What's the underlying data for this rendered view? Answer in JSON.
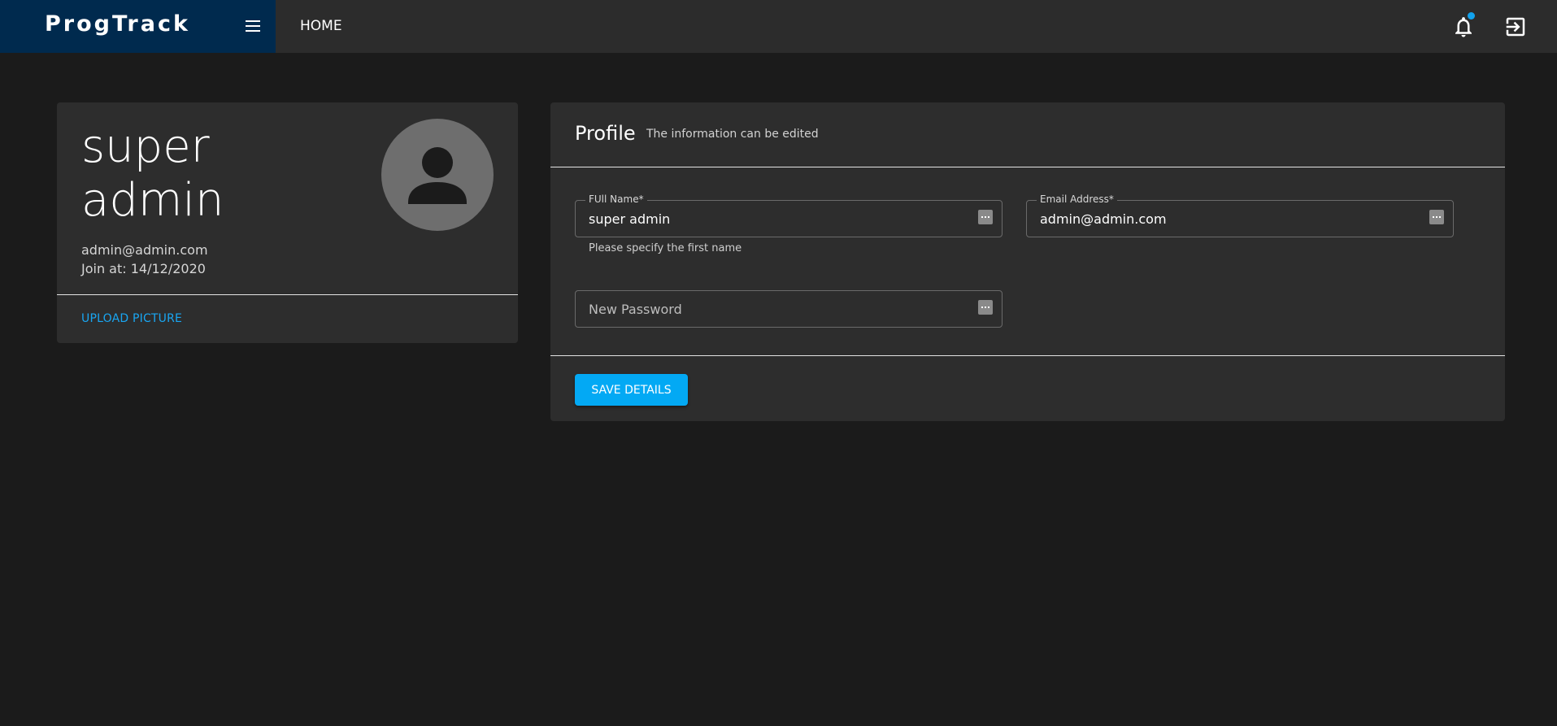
{
  "header": {
    "brand": "ProgTrack",
    "nav_home": "HOME",
    "menu_icon": "hamburger-menu-icon",
    "bell_icon": "bell-icon",
    "logout_icon": "logout-icon",
    "notification_dot_color": "#12a3ee"
  },
  "user_card": {
    "name": "super admin",
    "email": "admin@admin.com",
    "joined": "Join at: 14/12/2020",
    "upload_label": "UPLOAD PICTURE",
    "avatar_icon": "person-icon"
  },
  "profile": {
    "title": "Profile",
    "subtitle": "The information can be edited",
    "full_name_label": "FUll Name*",
    "full_name_value": "super admin",
    "full_name_helper": "Please specify the first name",
    "email_label": "Email Address*",
    "email_value": "admin@admin.com",
    "password_placeholder": "New Password",
    "save_label": "SAVE DETAILS"
  },
  "colors": {
    "accent": "#03a9f4",
    "brand_bg": "#002a4e",
    "link": "#19a6f2"
  }
}
